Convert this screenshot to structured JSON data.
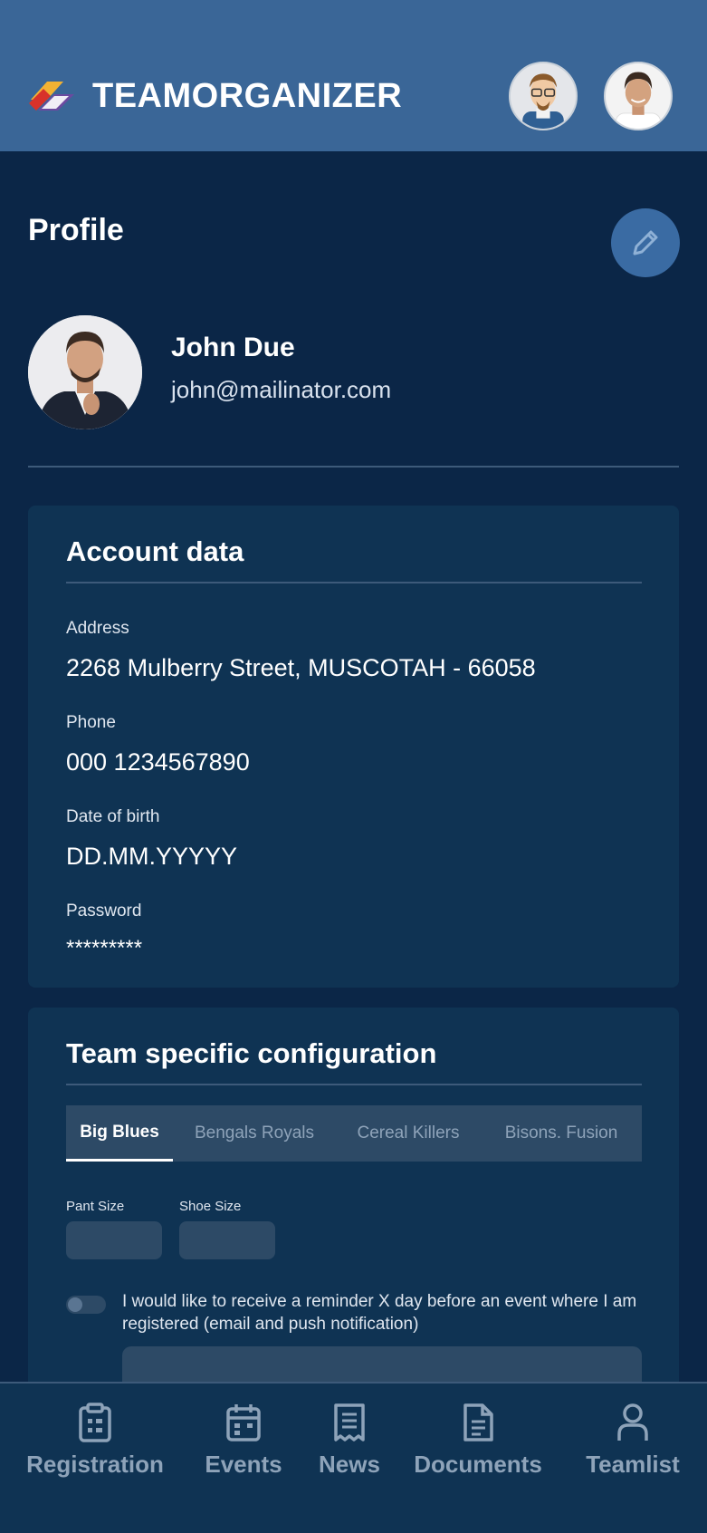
{
  "header": {
    "app_name": "TEAMORGANIZER",
    "logo_icon": "teamorganizer-logo",
    "avatars": [
      "avatar-cartoon-man",
      "avatar-smiling-man"
    ]
  },
  "profile": {
    "title": "Profile",
    "edit_icon": "pencil-icon",
    "name": "John Due",
    "email": "john@mailinator.com"
  },
  "account": {
    "title": "Account data",
    "fields": [
      {
        "label": "Address",
        "value": "2268 Mulberry Street, MUSCOTAH - 66058"
      },
      {
        "label": "Phone",
        "value": "000 1234567890"
      },
      {
        "label": "Date of birth",
        "value": "DD.MM.YYYYY"
      },
      {
        "label": "Password",
        "value": "*********"
      }
    ]
  },
  "team": {
    "title": "Team specific configuration",
    "tabs": [
      "Big Blues",
      "Bengals Royals",
      "Cereal Killers",
      "Bisons. Fusion"
    ],
    "active_tab": "Big Blues",
    "pant_label": "Pant Size",
    "shoe_label": "Shoe Size",
    "reminder_text": "I would like to receive a reminder X day before an event where I am registered (email and push notification)"
  },
  "nav": [
    {
      "label": "Registration",
      "icon": "clipboard-icon"
    },
    {
      "label": "Events",
      "icon": "calendar-icon"
    },
    {
      "label": "News",
      "icon": "receipt-icon"
    },
    {
      "label": "Documents",
      "icon": "document-icon"
    },
    {
      "label": "Teamlist",
      "icon": "person-icon"
    }
  ],
  "colors": {
    "background": "#0b2647",
    "header": "#3a6697",
    "card": "#0f3353",
    "input": "#2d4a66",
    "edit_button": "#3a6ba3",
    "nav_inactive": "#8ea3b9"
  }
}
